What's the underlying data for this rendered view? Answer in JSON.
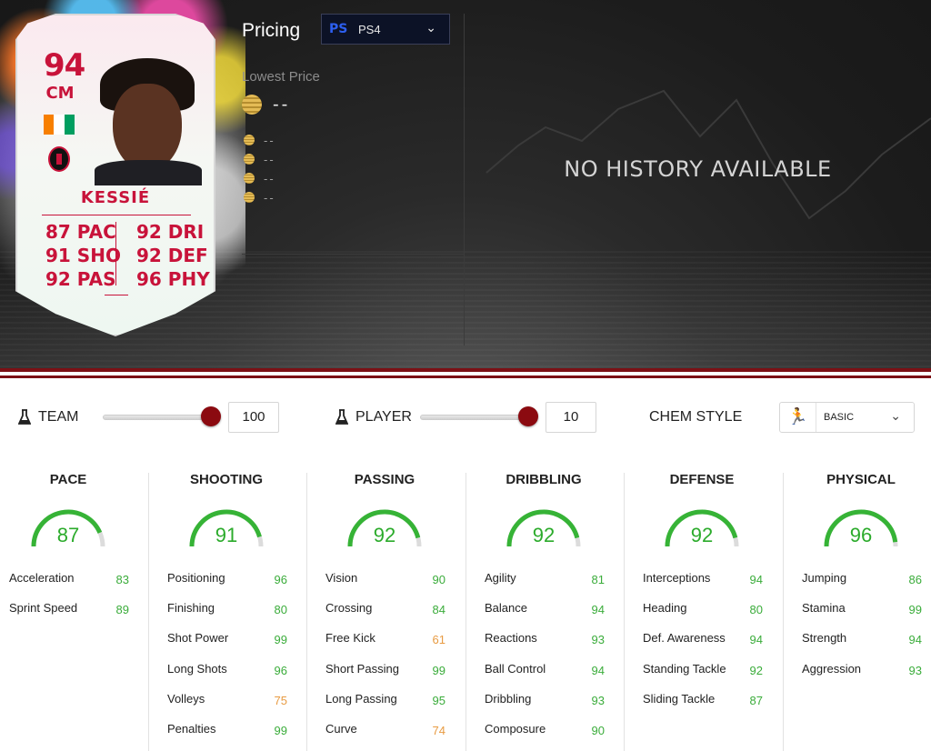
{
  "card": {
    "rating": "94",
    "position": "CM",
    "name": "KESSIÉ",
    "stats_left": [
      "87 PAC",
      "91 SHO",
      "92 PAS"
    ],
    "stats_right": [
      "92 DRI",
      "92 DEF",
      "96 PHY"
    ],
    "flag_colors": [
      "#f77f00",
      "#ffffff",
      "#009e60"
    ]
  },
  "pricing": {
    "title": "Pricing",
    "platform": "PS4",
    "lowest_label": "Lowest Price",
    "lowest_value": "--",
    "history": [
      "--",
      "--",
      "--",
      "--"
    ],
    "no_history": "NO HISTORY AVAILABLE"
  },
  "chem": {
    "team_label": "TEAM",
    "team_value": "100",
    "player_label": "PLAYER",
    "player_value": "10",
    "style_label": "CHEM STYLE",
    "style_value": "BASIC"
  },
  "columns": [
    {
      "title": "PACE",
      "value": "87",
      "attrs": [
        {
          "name": "Acceleration",
          "value": "83",
          "color": "g"
        },
        {
          "name": "Sprint Speed",
          "value": "89",
          "color": "g"
        }
      ]
    },
    {
      "title": "SHOOTING",
      "value": "91",
      "attrs": [
        {
          "name": "Positioning",
          "value": "96",
          "color": "g"
        },
        {
          "name": "Finishing",
          "value": "80",
          "color": "g"
        },
        {
          "name": "Shot Power",
          "value": "99",
          "color": "g"
        },
        {
          "name": "Long Shots",
          "value": "96",
          "color": "g"
        },
        {
          "name": "Volleys",
          "value": "75",
          "color": "o"
        },
        {
          "name": "Penalties",
          "value": "99",
          "color": "g"
        }
      ]
    },
    {
      "title": "PASSING",
      "value": "92",
      "attrs": [
        {
          "name": "Vision",
          "value": "90",
          "color": "g"
        },
        {
          "name": "Crossing",
          "value": "84",
          "color": "g"
        },
        {
          "name": "Free Kick",
          "value": "61",
          "color": "o"
        },
        {
          "name": "Short Passing",
          "value": "99",
          "color": "g"
        },
        {
          "name": "Long Passing",
          "value": "95",
          "color": "g"
        },
        {
          "name": "Curve",
          "value": "74",
          "color": "o"
        }
      ]
    },
    {
      "title": "DRIBBLING",
      "value": "92",
      "attrs": [
        {
          "name": "Agility",
          "value": "81",
          "color": "g"
        },
        {
          "name": "Balance",
          "value": "94",
          "color": "g"
        },
        {
          "name": "Reactions",
          "value": "93",
          "color": "g"
        },
        {
          "name": "Ball Control",
          "value": "94",
          "color": "g"
        },
        {
          "name": "Dribbling",
          "value": "93",
          "color": "g"
        },
        {
          "name": "Composure",
          "value": "90",
          "color": "g"
        }
      ]
    },
    {
      "title": "DEFENSE",
      "value": "92",
      "attrs": [
        {
          "name": "Interceptions",
          "value": "94",
          "color": "g"
        },
        {
          "name": "Heading",
          "value": "80",
          "color": "g"
        },
        {
          "name": "Def. Awareness",
          "value": "94",
          "color": "g"
        },
        {
          "name": "Standing Tackle",
          "value": "92",
          "color": "g"
        },
        {
          "name": "Sliding Tackle",
          "value": "87",
          "color": "g"
        }
      ]
    },
    {
      "title": "PHYSICAL",
      "value": "96",
      "attrs": [
        {
          "name": "Jumping",
          "value": "86",
          "color": "g"
        },
        {
          "name": "Stamina",
          "value": "99",
          "color": "g"
        },
        {
          "name": "Strength",
          "value": "94",
          "color": "g"
        },
        {
          "name": "Aggression",
          "value": "93",
          "color": "g"
        }
      ]
    }
  ]
}
